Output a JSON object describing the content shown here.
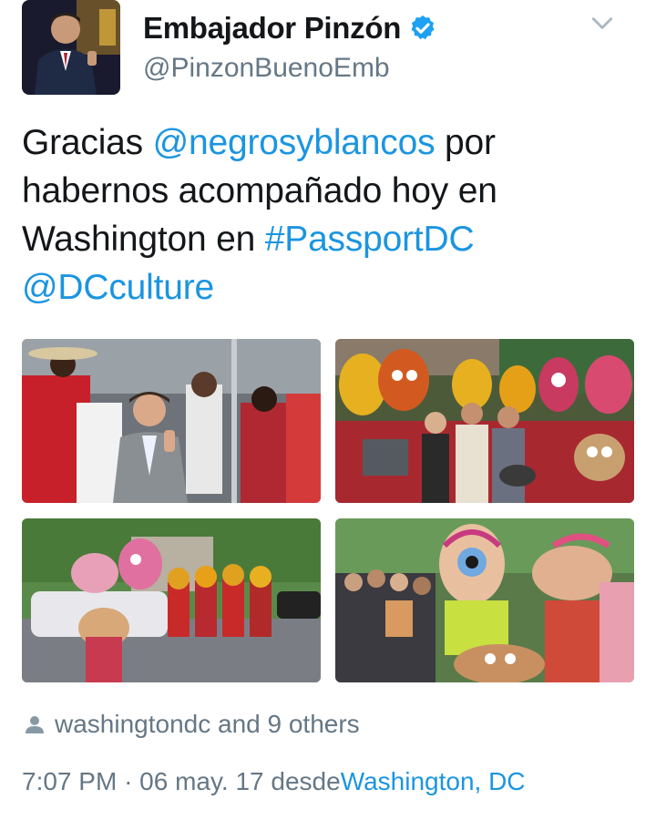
{
  "author": {
    "display_name": "Embajador Pinzón",
    "handle": "@PinzonBuenoEmb",
    "verified": true,
    "verified_icon": "verified-badge-icon"
  },
  "menu_icon": "chevron-down-icon",
  "tweet": {
    "lines": [
      [
        {
          "text": "Gracias ",
          "type": "text"
        },
        {
          "text": "@negrosyblancos",
          "type": "mention"
        },
        {
          "text": " por",
          "type": "text"
        }
      ],
      [
        {
          "text": "habernos acompañado hoy en",
          "type": "text"
        }
      ],
      [
        {
          "text": "Washington en ",
          "type": "text"
        },
        {
          "text": "#PassportDC",
          "type": "hashtag"
        }
      ],
      [
        {
          "text": "@DCculture",
          "type": "mention"
        }
      ]
    ]
  },
  "photos": [
    {
      "name": "speech-under-tent"
    },
    {
      "name": "group-with-masks"
    },
    {
      "name": "street-parade"
    },
    {
      "name": "parade-crowd-closeup"
    }
  ],
  "tagged": {
    "icon": "person-icon",
    "text": "washingtondc and 9 others"
  },
  "meta": {
    "time": "7:07 PM",
    "separator": "·",
    "date": "06 may. 17",
    "via_prefix": "desde",
    "place": "Washington, DC"
  },
  "colors": {
    "link": "#1b95e0",
    "text": "#14171a",
    "secondary": "#657786",
    "verified": "#1da1f2"
  }
}
